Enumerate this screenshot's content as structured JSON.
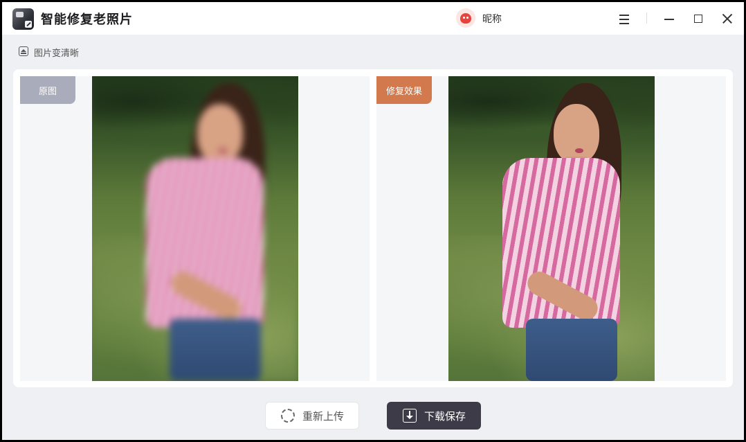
{
  "app": {
    "title": "智能修复老照片",
    "user_nickname": "昵称",
    "icons": {
      "logo": "app-logo-icon",
      "avatar": "bird-avatar-icon",
      "menu": "menu-icon",
      "minimize": "minimize-icon",
      "maximize": "maximize-icon",
      "close": "close-icon"
    }
  },
  "breadcrumb": {
    "icon": "home-icon",
    "label": "图片变清晰"
  },
  "compare": {
    "original_label": "原图",
    "restored_label": "修复效果"
  },
  "actions": {
    "reupload_label": "重新上传",
    "save_label": "下载保存"
  },
  "colors": {
    "original_tag": "#a9acbb",
    "restored_tag": "#d27a4d",
    "save_button": "#3d3b48",
    "background": "#eff0f3"
  }
}
